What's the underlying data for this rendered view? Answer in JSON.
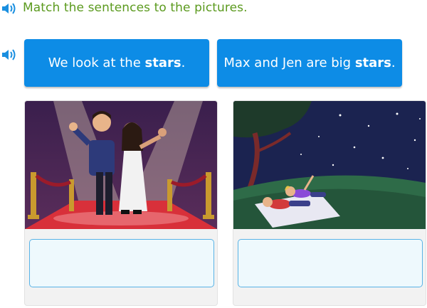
{
  "instruction": {
    "text": "Match the sentences to the pictures.",
    "icon": "speaker-icon"
  },
  "word_bank": {
    "icon": "speaker-icon",
    "tiles": [
      {
        "prefix": "We look at the ",
        "bold": "stars",
        "suffix": "."
      },
      {
        "prefix": "Max and Jen are big ",
        "bold": "stars",
        "suffix": "."
      }
    ]
  },
  "pictures": [
    {
      "scene": "celebrities-on-red-carpet"
    },
    {
      "scene": "kids-stargazing-at-night"
    }
  ],
  "colors": {
    "instruction_text": "#5b9a1e",
    "speaker": "#1a8fe0",
    "tile_bg": "#0d8ce6",
    "dropzone_border": "#59b3e6",
    "dropzone_bg": "#eef9fd",
    "card_bg": "#f2f2f2"
  }
}
